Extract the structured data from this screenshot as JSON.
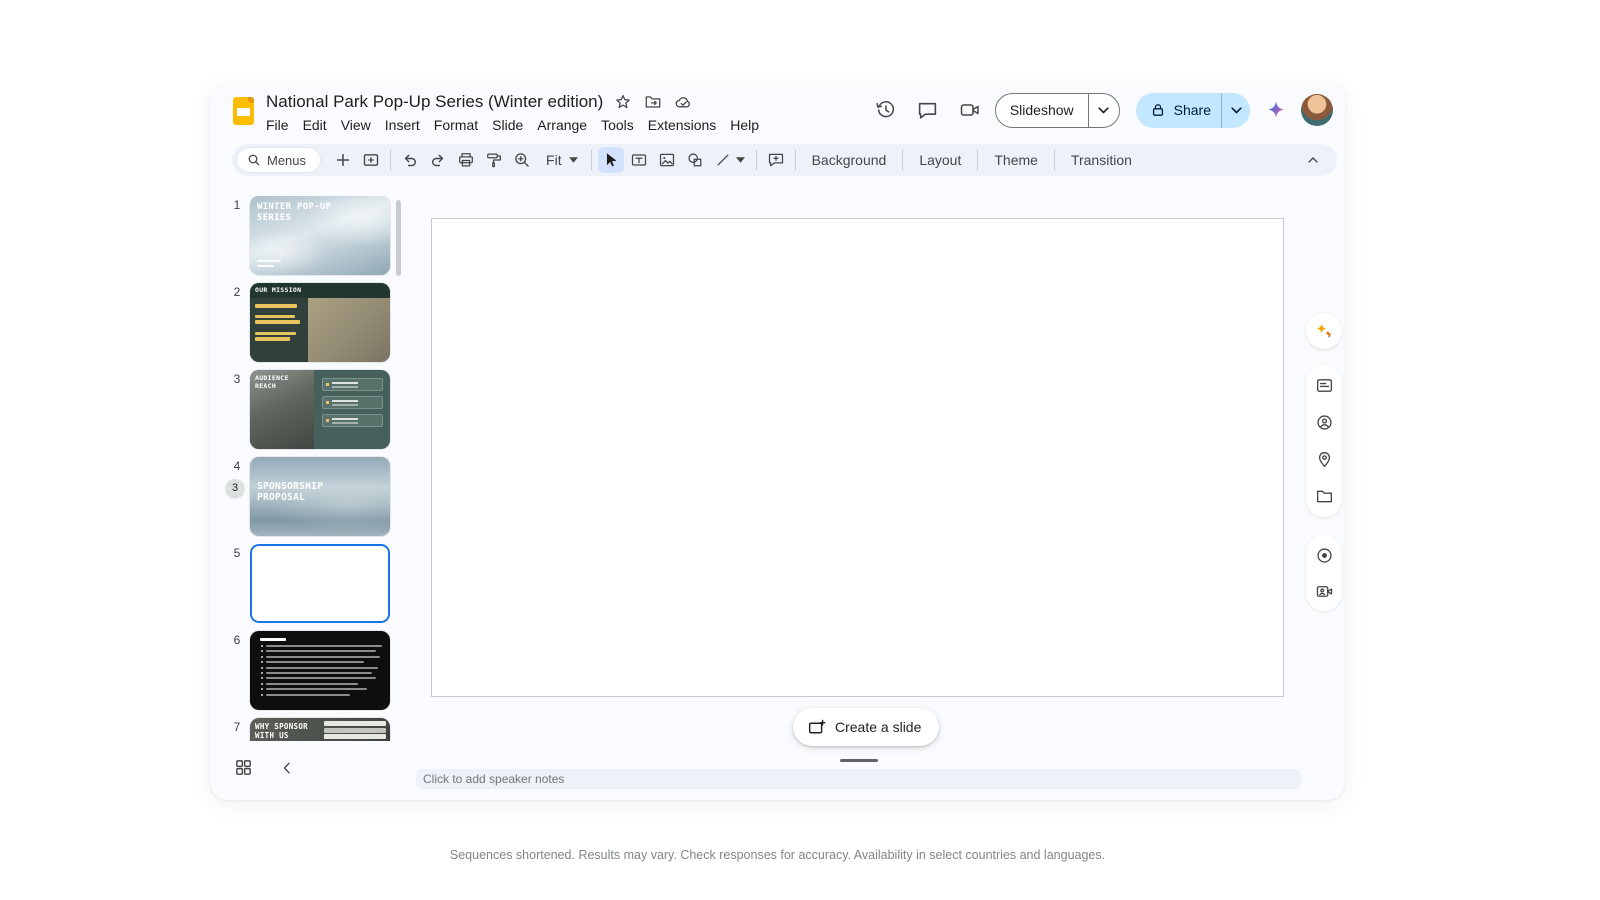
{
  "window": {
    "doc_title": "National Park Pop-Up Series (Winter edition)"
  },
  "menubar": {
    "items": [
      "File",
      "Edit",
      "View",
      "Insert",
      "Format",
      "Slide",
      "Arrange",
      "Tools",
      "Extensions",
      "Help"
    ]
  },
  "header_actions": {
    "slideshow_label": "Slideshow",
    "share_label": "Share"
  },
  "toolbar": {
    "menus_label": "Menus",
    "zoom_value": "Fit",
    "background_label": "Background",
    "layout_label": "Layout",
    "theme_label": "Theme",
    "transition_label": "Transition"
  },
  "filmstrip": {
    "drag_badge": "3",
    "slides": [
      {
        "number": "1",
        "title": "WINTER POP-UP SERIES"
      },
      {
        "number": "2",
        "title": "OUR MISSION"
      },
      {
        "number": "3",
        "title": "AUDIENCE REACH"
      },
      {
        "number": "4",
        "title": "SPONSORSHIP PROPOSAL"
      },
      {
        "number": "5",
        "title": ""
      },
      {
        "number": "6",
        "title": ""
      },
      {
        "number": "7",
        "title": "WHY SPONSOR WITH US"
      }
    ]
  },
  "canvas": {
    "create_slide_label": "Create a slide",
    "speaker_notes_placeholder": "Click to add speaker notes"
  },
  "caption": "Sequences shortened. Results may vary. Check responses for accuracy. Availability in select countries and languages.",
  "colors": {
    "accent_blue": "#1a73e8",
    "share_bg": "#c2e7ff",
    "toolbar_bg": "#edf2fa",
    "selected_tool_bg": "#d3e3fd",
    "slides_yellow": "#fbbc04"
  }
}
